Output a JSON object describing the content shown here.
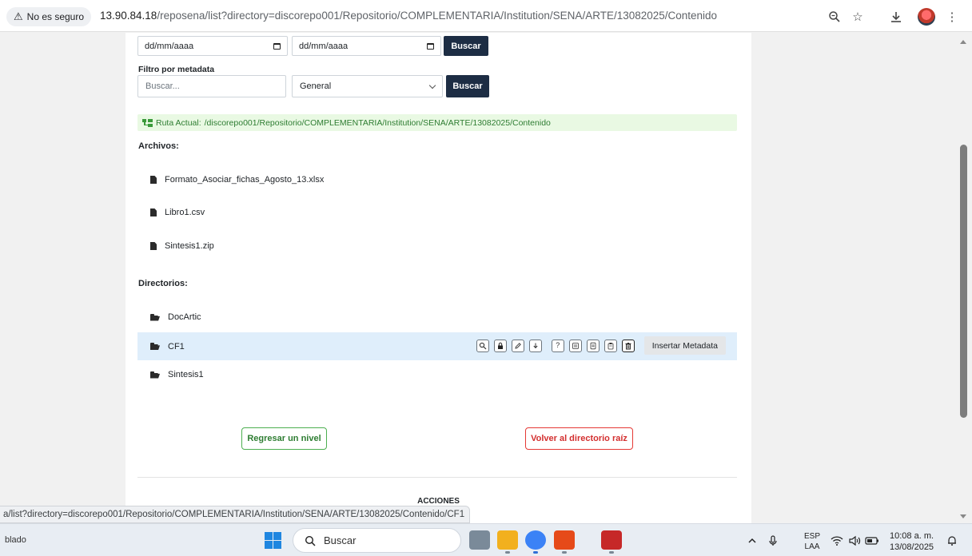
{
  "browser": {
    "security_label": "No es seguro",
    "url_domain": "13.90.84.18",
    "url_path": "/reposena/list?directory=discorepo001/Repositorio/COMPLEMENTARIA/Institution/SENA/ARTE/13082025/Contenido",
    "icons": [
      "zoom-icon",
      "star-icon",
      "download-icon",
      "profile-avatar",
      "menu-icon"
    ]
  },
  "filters": {
    "date_from_placeholder": "dd/mm/aaaa",
    "date_to_placeholder": "dd/mm/aaaa",
    "date_search_label": "Buscar",
    "metadata_label": "Filtro por metadata",
    "metadata_placeholder": "Buscar...",
    "metadata_select_value": "General",
    "metadata_search_label": "Buscar"
  },
  "ruta": {
    "label": "Ruta Actual:",
    "path": "/discorepo001/Repositorio/COMPLEMENTARIA/Institution/SENA/ARTE/13082025/Contenido"
  },
  "archivos": {
    "title": "Archivos:",
    "items": [
      {
        "name": "Formato_Asociar_fichas_Agosto_13.xlsx"
      },
      {
        "name": "Libro1.csv"
      },
      {
        "name": "Sintesis1.zip"
      }
    ]
  },
  "directorios": {
    "title": "Directorios:",
    "items": [
      {
        "name": "DocArtic"
      },
      {
        "name": "CF1"
      },
      {
        "name": "Sintesis1"
      }
    ],
    "insert_metadata_label": "Insertar Metadata"
  },
  "buttons": {
    "back_label": "Regresar un nivel",
    "root_label": "Volver al directorio raíz"
  },
  "acciones_title": "ACCIONES",
  "status_link": "a/list?directory=discorepo001/Repositorio/COMPLEMENTARIA/Institution/SENA/ARTE/13082025/Contenido/CF1",
  "taskbar": {
    "left_text": "blado",
    "search_label": "Buscar",
    "lang_line1": "ESP",
    "lang_line2": "LAA",
    "time": "10:08 a. m.",
    "date": "13/08/2025"
  },
  "colors": {
    "dark_button": "#1d2d44",
    "ruta_bg": "#e9f9e3",
    "highlight_row": "#dfeefb",
    "green": "#4caf50",
    "red": "#e53935"
  }
}
